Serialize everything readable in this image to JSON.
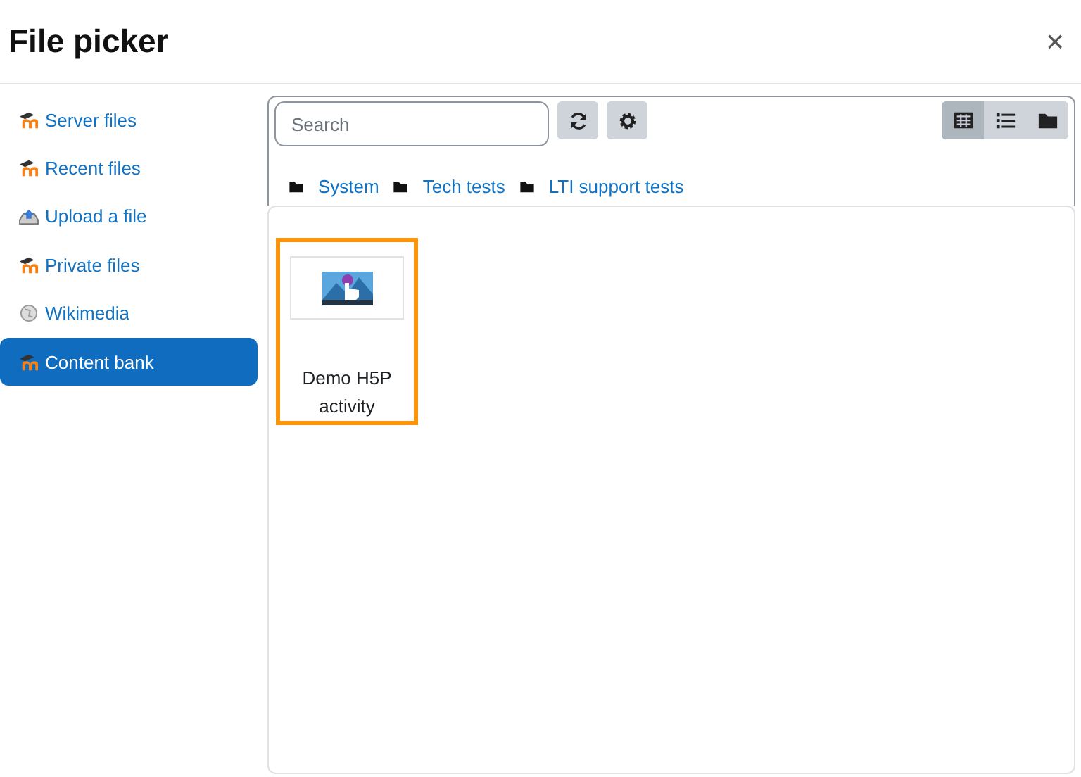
{
  "window": {
    "title": "File picker",
    "close": "×"
  },
  "sidebar": {
    "items": [
      {
        "label": "Server files",
        "kind": "moodle",
        "selected": false
      },
      {
        "label": "Recent files",
        "kind": "moodle",
        "selected": false
      },
      {
        "label": "Upload a file",
        "kind": "upload",
        "selected": false
      },
      {
        "label": "Private files",
        "kind": "moodle",
        "selected": false
      },
      {
        "label": "Wikimedia",
        "kind": "wiki",
        "selected": false
      },
      {
        "label": "Content bank",
        "kind": "moodle",
        "selected": true
      }
    ]
  },
  "toolbar": {
    "search": {
      "placeholder": "Search"
    },
    "views": [
      {
        "kind": "grid",
        "selected": true
      },
      {
        "kind": "list",
        "selected": false
      },
      {
        "kind": "tree",
        "selected": false
      }
    ]
  },
  "breadcrumb": [
    "System",
    "Tech tests",
    "LTI support tests"
  ],
  "files": [
    {
      "name": "Demo H5P activity",
      "selected": true
    }
  ]
}
